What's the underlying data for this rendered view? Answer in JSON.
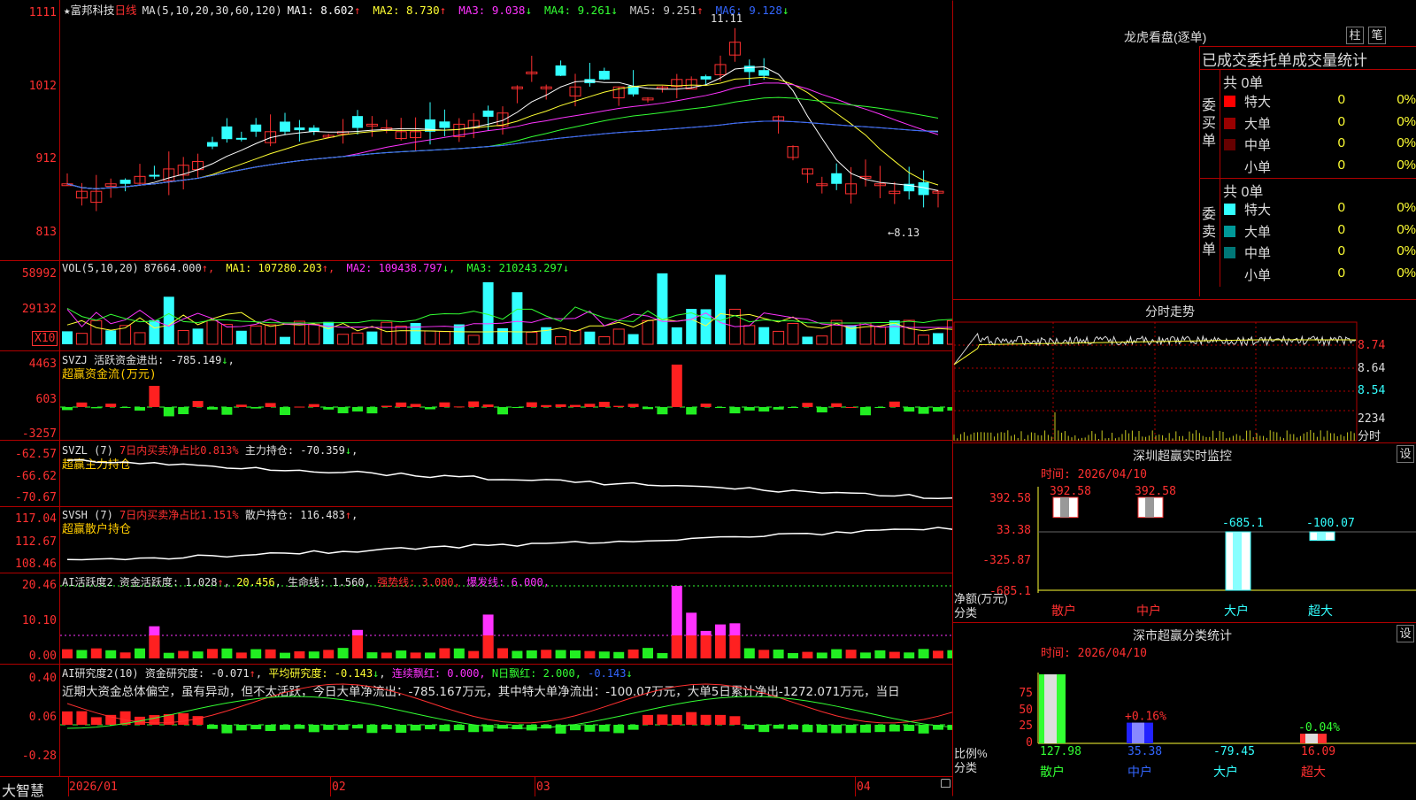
{
  "main_chart": {
    "star": "★",
    "stock_name": "富邦科技",
    "period": "日线",
    "ma_params": "MA(5,10,20,30,60,120)",
    "ma_values": [
      {
        "label": "MA1:",
        "value": "8.602",
        "arrow": "↑",
        "color": "#ffffff"
      },
      {
        "label": "MA2:",
        "value": "8.730",
        "arrow": "↑",
        "color": "#ffff33"
      },
      {
        "label": "MA3:",
        "value": "9.038",
        "arrow": "↓",
        "color": "#ff33ff"
      },
      {
        "label": "MA4:",
        "value": "9.261",
        "arrow": "↓",
        "color": "#33ff33"
      },
      {
        "label": "MA5:",
        "value": "9.251",
        "arrow": "↑",
        "color": "#cccccc"
      },
      {
        "label": "MA6:",
        "value": "9.128",
        "arrow": "↓",
        "color": "#3366ff"
      }
    ],
    "y_ticks": [
      "1111",
      "1012",
      "912",
      "813"
    ],
    "high_label": "11.11",
    "low_label": "8.13"
  },
  "vol_panel": {
    "header": "VOL(5,10,20)",
    "value": "87664.000",
    "ma1": "MA1: 107280.203",
    "ma2": "MA2: 109438.797",
    "ma3": "MA3: 210243.297",
    "y_ticks": [
      "58992",
      "29132"
    ],
    "unit": "X10"
  },
  "svzj_panel": {
    "line1": "SVZJ  活跃资金进出: -785.149",
    "line2": "超赢资金流(万元)",
    "y_ticks": [
      "4463",
      "603",
      "-3257"
    ]
  },
  "svzl_panel": {
    "name": "SVZL (7)",
    "desc": "7日内买卖净占比0.813%",
    "value": "主力持仓: -70.359",
    "line2": "超赢主力持仓",
    "y_ticks": [
      "-62.57",
      "-66.62",
      "-70.67"
    ]
  },
  "svsh_panel": {
    "name": "SVSH (7)",
    "desc": "7日内买卖净占比1.151%",
    "value": "散户持仓: 116.483",
    "line2": "超赢散户持仓",
    "y_ticks": [
      "117.04",
      "112.67",
      "108.46"
    ]
  },
  "ai_active_panel": {
    "name": "AI活跃度2",
    "v1": "资金活跃度: 1.028",
    "v2": "20.456",
    "v3": "生命线: 1.560,",
    "v4": "强势线: 3.000,",
    "v5": "爆发线: 6.000,",
    "y_ticks": [
      "20.46",
      "10.10",
      "0.00"
    ]
  },
  "ai_research_panel": {
    "name": "AI研究度2(10)",
    "v1": "资金研究度: -0.071",
    "v2": "平均研究度: -0.143",
    "v3": "连续飘红: 0.000,",
    "v4": "N日飘红: 2.000,",
    "v5": "-0.143",
    "comment": "近期大资金总体偏空，虽有异动，但不太活跃，今日大单净流出：-785.167万元，其中特大单净流出：-100.07万元，大单5日累计净出-1272.071万元，当日",
    "y_ticks": [
      "0.40",
      "0.06",
      "-0.28"
    ]
  },
  "x_axis": {
    "brand": "大智慧",
    "labels": [
      "2026/01",
      "02",
      "03",
      "04"
    ]
  },
  "dragon_tiger": {
    "title": "龙虎看盘(逐单)",
    "btn1": "柱",
    "btn2": "笔",
    "subtitle": "已成交委托单成交量统计",
    "buy_label": "委买单",
    "sell_label": "委卖单",
    "buy_total": "共 0单",
    "sell_total": "共 0单",
    "buy_rows": [
      {
        "name": "特大",
        "count": "0",
        "pct": "0%",
        "color": "#ff0000"
      },
      {
        "name": "大单",
        "count": "0",
        "pct": "0%",
        "color": "#990000"
      },
      {
        "name": "中单",
        "count": "0",
        "pct": "0%",
        "color": "#660000"
      },
      {
        "name": "小单",
        "count": "0",
        "pct": "0%",
        "color": ""
      }
    ],
    "sell_rows": [
      {
        "name": "特大",
        "count": "0",
        "pct": "0%",
        "color": "#33ffff"
      },
      {
        "name": "大单",
        "count": "0",
        "pct": "0%",
        "color": "#009999"
      },
      {
        "name": "中单",
        "count": "0",
        "pct": "0%",
        "color": "#007777"
      },
      {
        "name": "小单",
        "count": "0",
        "pct": "0%",
        "color": ""
      }
    ]
  },
  "intraday": {
    "title": "分时走势",
    "y_ticks": [
      "8.74",
      "8.64",
      "8.54"
    ],
    "vol_label": "2234",
    "vol_unit": "分时"
  },
  "sz_monitor": {
    "title": "深圳超赢实时监控",
    "btn": "设",
    "time": "时间: 2026/04/10",
    "y_ticks": [
      "392.58",
      "33.38",
      "-325.87",
      "-685.1"
    ],
    "y_caption": "净额(万元)",
    "x_caption": "分类",
    "bars": [
      {
        "label": "散户",
        "value": "392.58",
        "v": 392.58,
        "lcolor": "#ff3030",
        "vcolor": "#ff3030"
      },
      {
        "label": "中户",
        "value": "392.58",
        "v": 392.58,
        "lcolor": "#ff3030",
        "vcolor": "#ff3030"
      },
      {
        "label": "大户",
        "value": "-685.1",
        "v": -685.1,
        "lcolor": "#33ffff",
        "vcolor": "#33ffff"
      },
      {
        "label": "超大",
        "value": "-100.07",
        "v": -100.07,
        "lcolor": "#33ffff",
        "vcolor": "#33ffff"
      }
    ]
  },
  "sz_class": {
    "title": "深市超赢分类统计",
    "btn": "设",
    "time": "时间: 2026/04/10",
    "y_ticks": [
      "75",
      "50",
      "25",
      "0"
    ],
    "y_caption": "比例%",
    "x_caption": "分类",
    "bars": [
      {
        "label": "散户",
        "value": "127.98",
        "pct": "",
        "h": 100,
        "color": "#33ff33",
        "lcolor": "#33ff33"
      },
      {
        "label": "中户",
        "value": "35.38",
        "pct": "+0.16%",
        "h": 30,
        "color": "#2222ff",
        "lcolor": "#3366ff"
      },
      {
        "label": "大户",
        "value": "-79.45",
        "pct": "",
        "h": 0,
        "color": "#33ffff",
        "lcolor": "#33ffff"
      },
      {
        "label": "超大",
        "value": "16.09",
        "pct": "-0.04%",
        "h": 14,
        "color": "#ff3030",
        "lcolor": "#ff3030"
      }
    ]
  }
}
